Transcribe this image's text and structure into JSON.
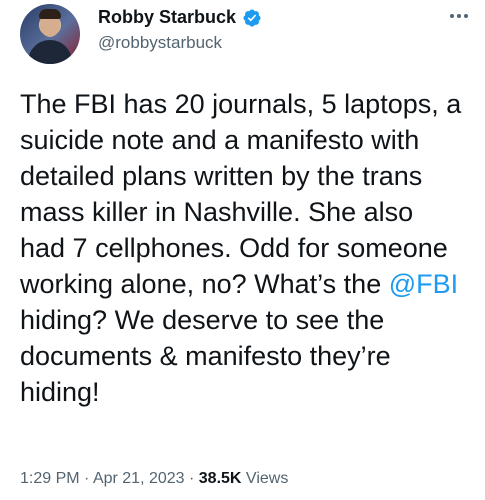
{
  "author": {
    "display_name": "Robby Starbuck",
    "handle": "@robbystarbuck"
  },
  "tweet": {
    "text_before": "The FBI has 20 journals, 5 laptops, a suicide note and a manifesto with detailed plans written by the trans mass killer in Nashville. She also had 7 cellphones. Odd for someone working alone, no? What’s the ",
    "mention": "@FBI",
    "text_after": " hiding? We deserve to see the documents & manifesto they’re hiding!"
  },
  "meta": {
    "time": "1:29 PM",
    "separator": " · ",
    "date": "Apr 21, 2023",
    "views_count": "38.5K",
    "views_label": " Views"
  },
  "icons": {
    "verified": "verified-badge-icon",
    "more": "more-options-icon"
  },
  "colors": {
    "accent": "#1d9bf0",
    "secondary_text": "#536471",
    "primary_text": "#0f1419"
  }
}
